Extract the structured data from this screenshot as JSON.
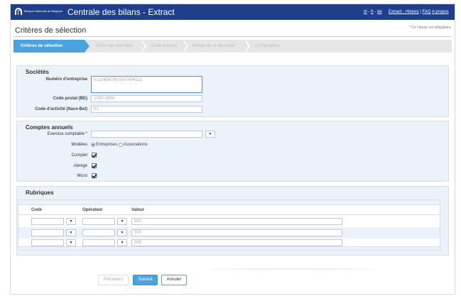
{
  "header": {
    "logo_text": "Banque Nationale de Belgique",
    "app_title": "Centrale des bilans - Extract",
    "languages": [
      "nl",
      "fr",
      "de"
    ],
    "language_separator": " - ",
    "links": [
      "Extract - History",
      "FAQ",
      "A propos"
    ],
    "link_separator": " | "
  },
  "page": {
    "title": "Critères de sélection",
    "required_note": "* Ce champ est obligatoire."
  },
  "steps": [
    "Critères de sélection",
    "Choix des données",
    "Code d'accès",
    "Détails de la demande",
    "Confirmation"
  ],
  "societes": {
    "title": "Sociétés",
    "enterprise_label": "Numéro d'entreprise",
    "enterprise_placeholder": "0123456789;0987654321",
    "postal_label": "Code postal (BE)",
    "postal_placeholder": "1000-1999",
    "nace_label": "Code d'activité (Nace-Bel)",
    "nace_placeholder": "01"
  },
  "comptes": {
    "title": "Comptes annuels",
    "exercise_label": "Exercice comptable *",
    "exercise_value": "",
    "dropdown_symbol": "▼",
    "models_label": "Modèles",
    "model_options": [
      "Entreprises",
      "Associations"
    ],
    "model_selected": "Entreprises",
    "complet_label": "Complet",
    "abrege_label": "Abrégé",
    "micro_label": "Micro"
  },
  "rubriques": {
    "title": "Rubriques",
    "columns": [
      "Code",
      "Opérateur",
      "Valeur"
    ],
    "rows": [
      {
        "code": "",
        "operator": "",
        "value_placeholder": "500"
      },
      {
        "code": "",
        "operator": "",
        "value_placeholder": "500"
      },
      {
        "code": "",
        "operator": "",
        "value_placeholder": "500"
      }
    ]
  },
  "buttons": {
    "previous": "Précédent",
    "next": "Suivant",
    "cancel": "Annuler"
  },
  "colors": {
    "header_bg": "#1f3f8c",
    "accent": "#4aa3df",
    "panel_bg": "#ecf2f9"
  }
}
